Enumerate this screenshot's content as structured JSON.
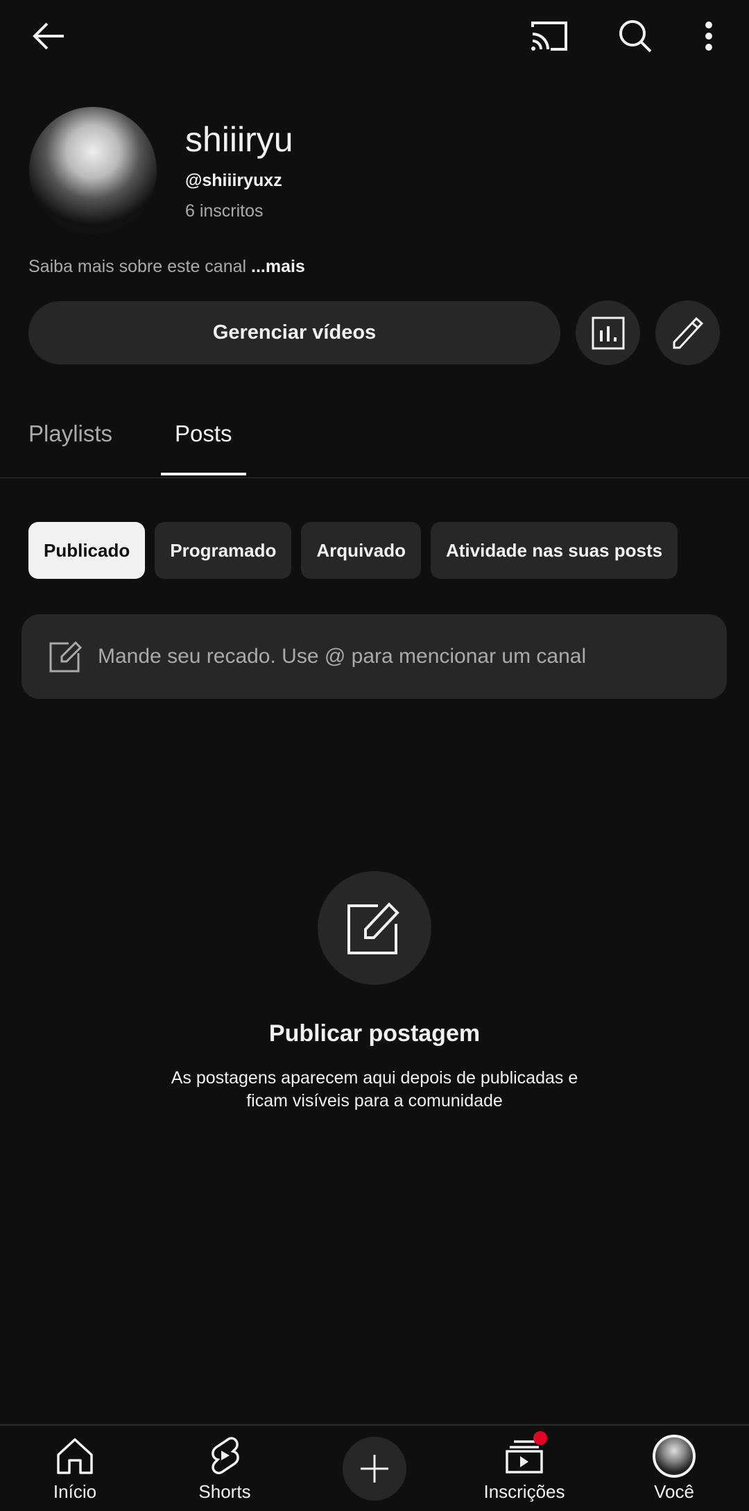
{
  "channel": {
    "name": "shiiiryu",
    "handle": "@shiiiryuxz",
    "subscribers": "6 inscritos",
    "about": "Saiba mais sobre este canal",
    "more": "...mais"
  },
  "actions": {
    "manage_videos": "Gerenciar vídeos"
  },
  "tabs": [
    {
      "label": "Playlists",
      "active": false
    },
    {
      "label": "Posts",
      "active": true
    }
  ],
  "chips": [
    {
      "label": "Publicado",
      "active": true
    },
    {
      "label": "Programado",
      "active": false
    },
    {
      "label": "Arquivado",
      "active": false
    },
    {
      "label": "Atividade nas suas posts",
      "active": false
    }
  ],
  "post_input": {
    "placeholder": "Mande seu recado. Use @ para mencionar um canal"
  },
  "empty_state": {
    "title": "Publicar postagem",
    "line1": "As postagens aparecem aqui depois de publicadas e",
    "line2": "ficam visíveis para a comunidade"
  },
  "nav": [
    {
      "label": "Início",
      "icon": "home-icon"
    },
    {
      "label": "Shorts",
      "icon": "shorts-icon"
    },
    {
      "label": "",
      "icon": "plus-icon"
    },
    {
      "label": "Inscrições",
      "icon": "subscriptions-icon",
      "badge": true
    },
    {
      "label": "Você",
      "icon": "avatar"
    }
  ],
  "colors": {
    "background": "#0f0f0f",
    "surface": "#272727",
    "badge": "#e00525"
  }
}
